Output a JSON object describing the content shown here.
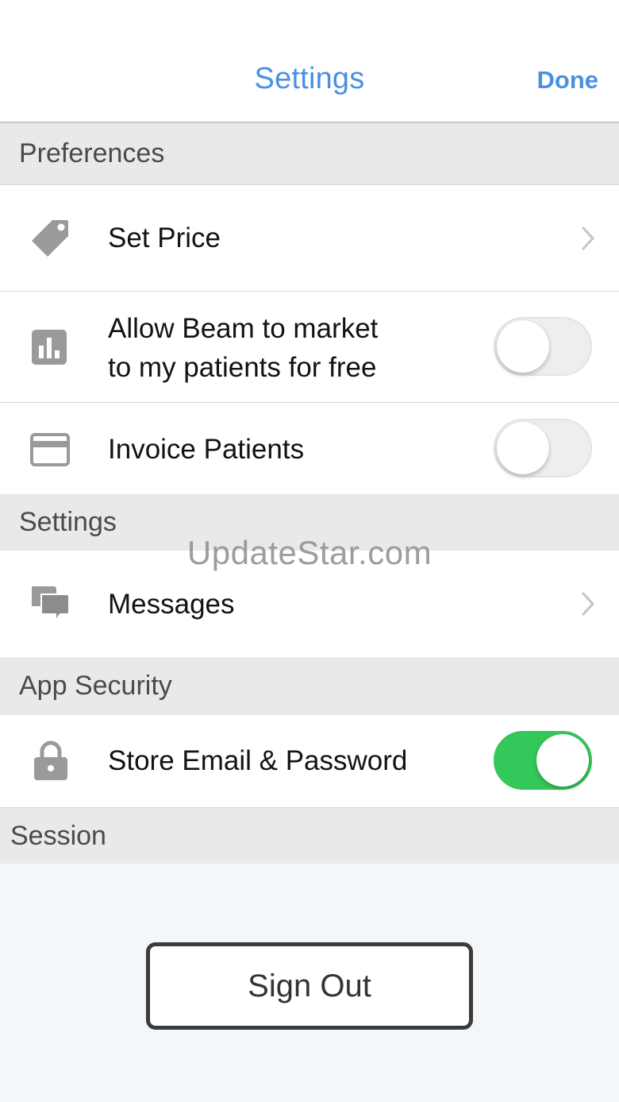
{
  "navbar": {
    "title": "Settings",
    "done_label": "Done"
  },
  "sections": {
    "preferences": "Preferences",
    "settings": "Settings",
    "app_security": "App Security",
    "session": "Session"
  },
  "rows": {
    "set_price": {
      "label": "Set Price",
      "icon": "price-tag-icon"
    },
    "allow_beam": {
      "label_line1": "Allow Beam to market",
      "label_line2": "to my patients for free",
      "icon": "bar-chart-icon",
      "enabled": false
    },
    "invoice_patients": {
      "label": "Invoice Patients",
      "icon": "credit-card-icon",
      "enabled": false
    },
    "messages": {
      "label": "Messages",
      "icon": "chat-bubbles-icon"
    },
    "store_credentials": {
      "label": "Store Email & Password",
      "icon": "lock-icon",
      "enabled": true
    }
  },
  "session": {
    "sign_out_label": "Sign Out"
  },
  "watermark": "UpdateStar.com",
  "colors": {
    "accent": "#4a90e2",
    "toggle_on": "#34c759",
    "section_bg": "#e9e9ea",
    "icon_gray": "#9a9a9a"
  }
}
